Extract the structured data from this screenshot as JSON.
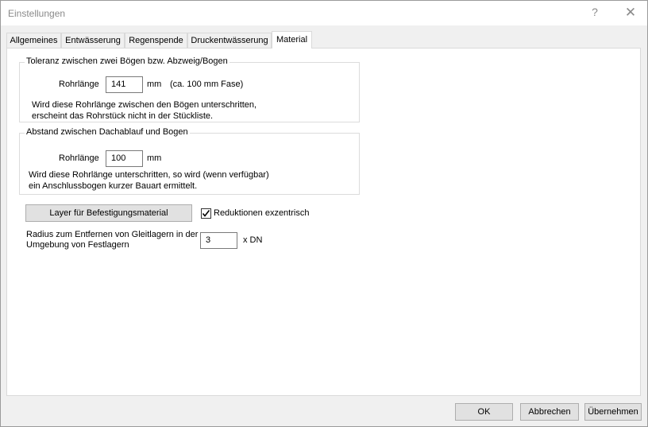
{
  "window": {
    "title": "Einstellungen",
    "help_glyph": "?",
    "close_glyph": "✕"
  },
  "tabs": [
    {
      "label": "Allgemeines",
      "active": false
    },
    {
      "label": "Entwässerung",
      "active": false
    },
    {
      "label": "Regenspende",
      "active": false
    },
    {
      "label": "Druckentwässerung",
      "active": false
    },
    {
      "label": "Material",
      "active": true
    }
  ],
  "group_tolerance": {
    "title": "Toleranz zwischen zwei Bögen bzw. Abzweig/Bogen",
    "field_label": "Rohrlänge",
    "value": "141",
    "unit": "mm",
    "hint": "(ca. 100 mm Fase)",
    "description_line1": "Wird diese Rohrlänge zwischen den Bögen unterschritten,",
    "description_line2": "erscheint das Rohrstück nicht in der Stückliste."
  },
  "group_distance": {
    "title": "Abstand zwischen Dachablauf und Bogen",
    "field_label": "Rohrlänge",
    "value": "100",
    "unit": "mm",
    "description_line1": "Wird diese Rohrlänge unterschritten, so wird (wenn verfügbar)",
    "description_line2": "ein Anschlussbogen kurzer Bauart ermittelt."
  },
  "layer_button_label": "Layer für Befestigungsmaterial",
  "reduktionen": {
    "label": "Reduktionen exzentrisch",
    "checked": true
  },
  "radius": {
    "label_line1": "Radius zum Entfernen von Gleitlagern in der",
    "label_line2": "Umgebung von Festlagern",
    "value": "3",
    "unit": "x DN"
  },
  "footer": {
    "ok_label": "OK",
    "cancel_label": "Abbrechen",
    "apply_label": "Übernehmen"
  }
}
